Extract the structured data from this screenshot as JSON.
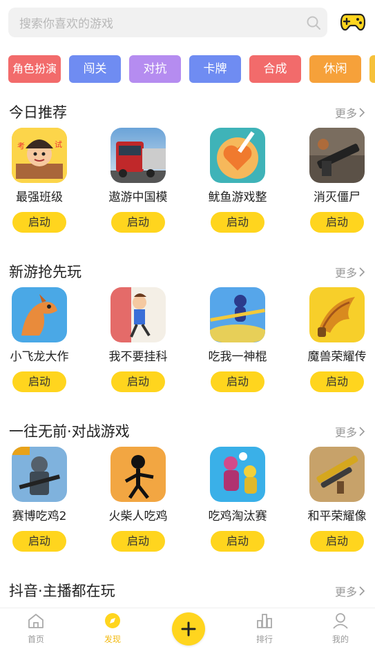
{
  "search": {
    "placeholder": "搜索你喜欢的游戏"
  },
  "categories": [
    {
      "label": "角色扮演",
      "color": "#f26b6b"
    },
    {
      "label": "闯关",
      "color": "#6f8cf2"
    },
    {
      "label": "对抗",
      "color": "#b58cf0"
    },
    {
      "label": "卡牌",
      "color": "#6f8cf2"
    },
    {
      "label": "合成",
      "color": "#f26b6b"
    },
    {
      "label": "休闲",
      "color": "#f6a13a"
    },
    {
      "label": "",
      "color": "#f6c13a"
    }
  ],
  "launch_label": "启动",
  "more_label": "更多",
  "sections": [
    {
      "title": "今日推荐",
      "games": [
        {
          "name": "最强班级"
        },
        {
          "name": "遨游中国模"
        },
        {
          "name": "鱿鱼游戏整"
        },
        {
          "name": "消灭僵尸"
        }
      ]
    },
    {
      "title": "新游抢先玩",
      "games": [
        {
          "name": "小飞龙大作"
        },
        {
          "name": "我不要挂科"
        },
        {
          "name": "吃我一神棍"
        },
        {
          "name": "魔兽荣耀传"
        }
      ]
    },
    {
      "title": "一往无前·对战游戏",
      "games": [
        {
          "name": "赛博吃鸡2"
        },
        {
          "name": "火柴人吃鸡"
        },
        {
          "name": "吃鸡淘汰赛"
        },
        {
          "name": "和平荣耀像"
        }
      ]
    },
    {
      "title": "抖音·主播都在玩"
    }
  ],
  "nav": {
    "home": "首页",
    "discover": "发现",
    "rank": "排行",
    "mine": "我的"
  },
  "colors": {
    "accent": "#ffd51e",
    "active_nav": "#f2b90f"
  }
}
